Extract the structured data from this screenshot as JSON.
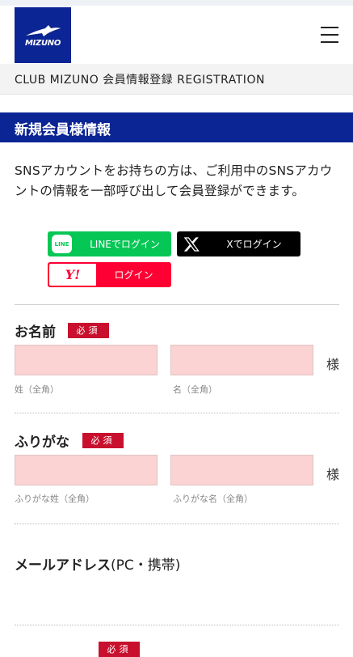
{
  "header": {
    "logo_text": "MIZUNO",
    "menu_icon": "hamburger-menu-icon"
  },
  "subbar": {
    "title": "CLUB MIZUNO 会員情報登録 REGISTRATION"
  },
  "section": {
    "title": "新規会員様情報"
  },
  "intro": "SNSアカウントをお持ちの方は、ご利用中のSNSアカウントの情報を一部呼び出して会員登録ができます。",
  "sns": {
    "line": {
      "icon_text": "LINE",
      "label": "LINEでログイン",
      "color": "#06c755"
    },
    "x": {
      "label": "Xでログイン",
      "color": "#000000"
    },
    "yahoo": {
      "icon_text": "Y!",
      "label": "ログイン",
      "color": "#ff0033"
    }
  },
  "form": {
    "required_badge": "必須",
    "name": {
      "label": "お名前",
      "last_hint": "姓（全角）",
      "first_hint": "名（全角）",
      "suffix": "様"
    },
    "furigana": {
      "label": "ふりがな",
      "last_hint": "ふりがな姓（全角）",
      "first_hint": "ふりがな名（全角）",
      "suffix": "様"
    },
    "email": {
      "label": "メールアドレス",
      "label_note": "(PC・携帯)"
    }
  },
  "colors": {
    "brand": "#0c2594",
    "required": "#c8102e",
    "input_bg": "#fbd3d3"
  }
}
